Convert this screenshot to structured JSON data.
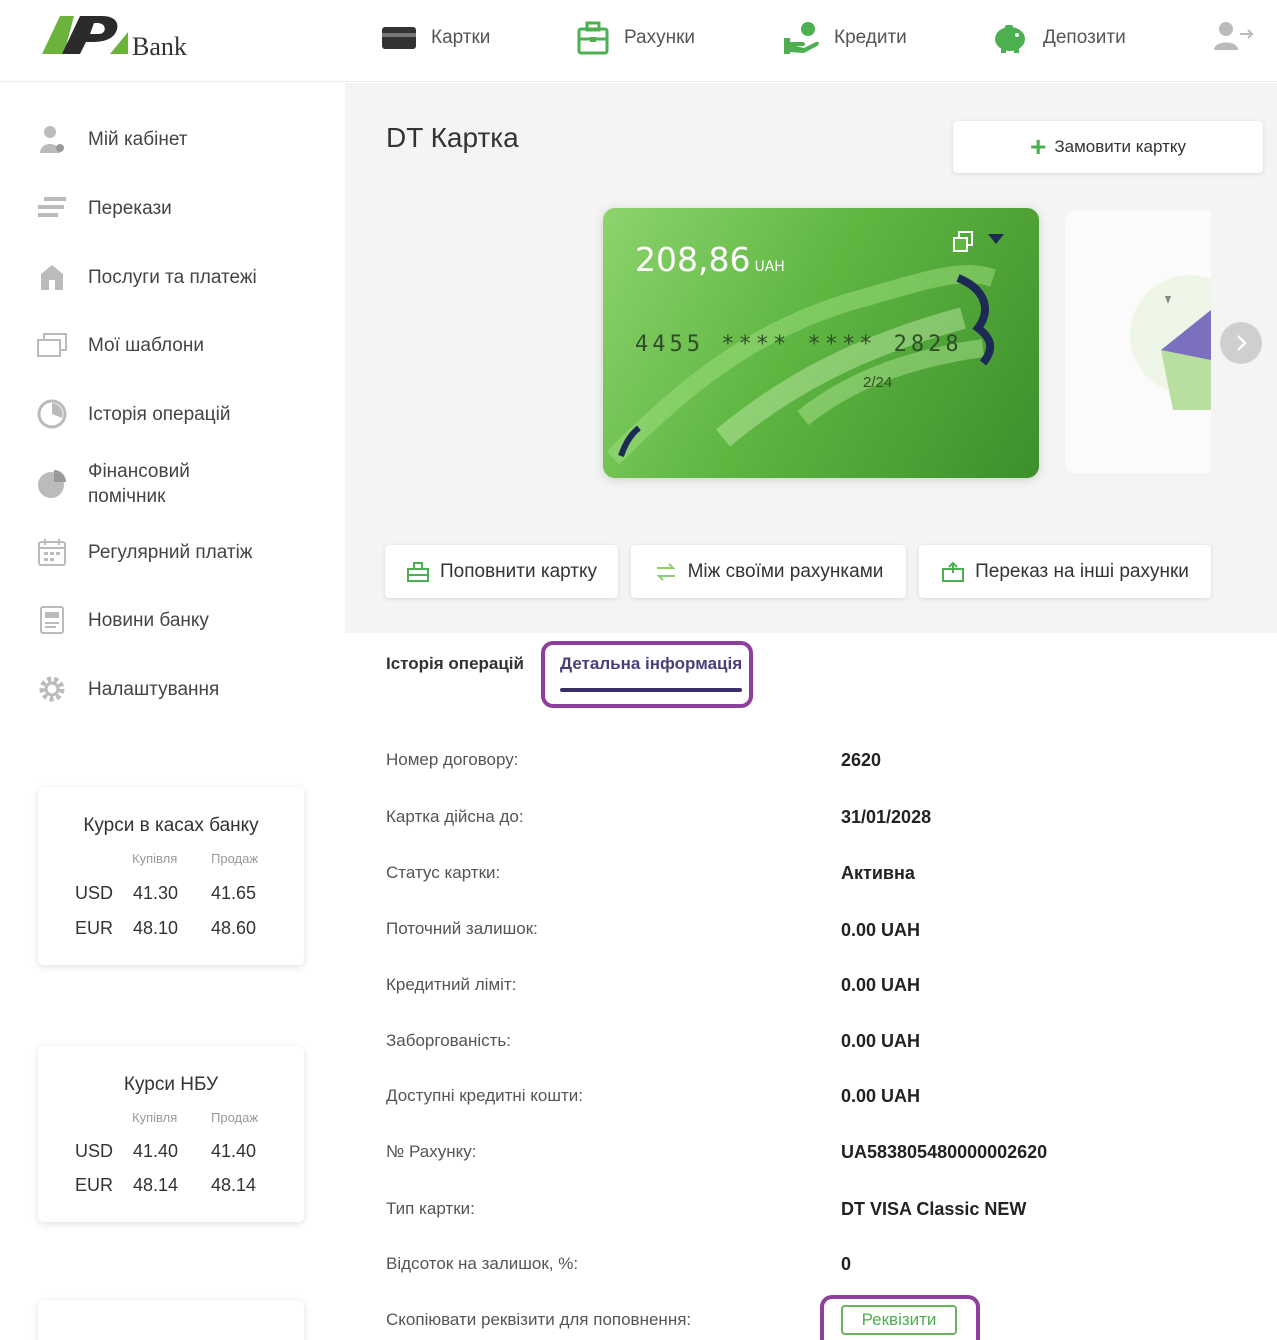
{
  "header": {
    "brand": "Bank",
    "nav": [
      {
        "label": "Картки",
        "icon": "card-icon"
      },
      {
        "label": "Рахунки",
        "icon": "briefcase-icon"
      },
      {
        "label": "Кредити",
        "icon": "credit-hand-icon"
      },
      {
        "label": "Депозити",
        "icon": "piggy-bank-icon"
      }
    ],
    "logout_icon": "logout-user-icon"
  },
  "sidebar": {
    "items": [
      {
        "label": "Мій кабінет",
        "icon": "user-icon"
      },
      {
        "label": "Перекази",
        "icon": "transfer-icon"
      },
      {
        "label": "Послуги та платежі",
        "icon": "shop-icon"
      },
      {
        "label": "Мої шаблони",
        "icon": "templates-icon"
      },
      {
        "label": "Історія операцій",
        "icon": "clock-icon"
      },
      {
        "label": "Фінансовий помічник",
        "icon": "pie-chart-icon"
      },
      {
        "label": "Регулярний платіж",
        "icon": "calendar-icon"
      },
      {
        "label": "Новини банку",
        "icon": "news-icon"
      },
      {
        "label": "Налаштування",
        "icon": "gear-icon"
      }
    ],
    "bank_rates": {
      "title": "Курси в касах банку",
      "buy": "Купівля",
      "sell": "Продаж",
      "rows": [
        {
          "cur": "USD",
          "buy": "41.30",
          "sell": "41.65"
        },
        {
          "cur": "EUR",
          "buy": "48.10",
          "sell": "48.60"
        }
      ]
    },
    "nbu_rates": {
      "title": "Курси НБУ",
      "buy": "Купівля",
      "sell": "Продаж",
      "rows": [
        {
          "cur": "USD",
          "buy": "41.40",
          "sell": "41.40"
        },
        {
          "cur": "EUR",
          "buy": "48.14",
          "sell": "48.14"
        }
      ]
    }
  },
  "main": {
    "title": "DT Картка",
    "order_button": "Замовити картку",
    "card": {
      "balance": "208,86",
      "currency": "UAH",
      "number": "4455 **** **** 2828",
      "expiry": "2/24"
    },
    "actions": [
      {
        "label": "Поповнити картку"
      },
      {
        "label": "Між своїми рахунками"
      },
      {
        "label": "Переказ на інші рахунки"
      }
    ],
    "tabs": [
      {
        "label": "Історія операцій"
      },
      {
        "label": "Детальна інформація"
      }
    ],
    "details": [
      {
        "label": "Номер договору:",
        "value": "2620"
      },
      {
        "label": "Картка дійсна до:",
        "value": "31/01/2028"
      },
      {
        "label": "Статус картки:",
        "value": "Активна"
      },
      {
        "label": "Поточний залишок:",
        "value": "0.00 UAH"
      },
      {
        "label": "Кредитний ліміт:",
        "value": "0.00 UAH"
      },
      {
        "label": "Заборгованість:",
        "value": "0.00 UAH"
      },
      {
        "label": "Доступні кредитні кошти:",
        "value": "0.00 UAH"
      },
      {
        "label": "№ Рахунку:",
        "value": "UA583805480000002620"
      },
      {
        "label": "Тип картки:",
        "value": "DT VISA Classic NEW"
      },
      {
        "label": "Відсоток на залишок, %:",
        "value": "0"
      },
      {
        "label": "Скопіювати реквізити для поповнення:",
        "value": ""
      }
    ],
    "requisites_button": "Реквізити"
  },
  "colors": {
    "accent_green": "#4caf50",
    "tab_active": "#3a2f6b",
    "highlight": "#8e3e9b",
    "main_bg": "#f4f4f4"
  }
}
